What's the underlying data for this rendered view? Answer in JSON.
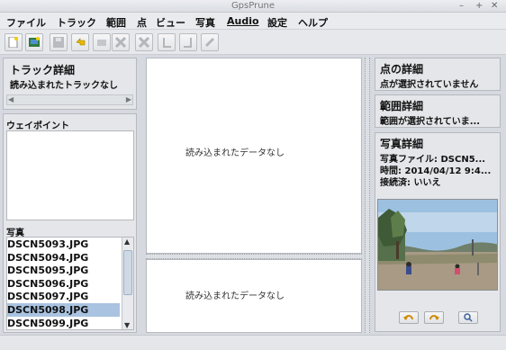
{
  "window": {
    "title": "GpsPrune",
    "minimize": "–",
    "maximize": "+",
    "close": "✕"
  },
  "menu": [
    "ファイル",
    "トラック",
    "範囲",
    "点",
    "ビュー",
    "写真",
    "Audio",
    "設定",
    "ヘルプ"
  ],
  "toolbar": {
    "icons": [
      "new-icon",
      "open-icon",
      "save-icon",
      "undo-icon",
      "edit-point-icon",
      "delete-point-icon",
      "delete-range-icon",
      "mark-start-icon",
      "mark-end-icon",
      "connect-icon"
    ]
  },
  "left": {
    "track_title": "トラック詳細",
    "track_status": "読み込まれたトラックなし",
    "waypoints_title": "ウェイポイント",
    "photos_title": "写真",
    "photos": [
      "DSCN5093.JPG",
      "DSCN5094.JPG",
      "DSCN5095.JPG",
      "DSCN5096.JPG",
      "DSCN5097.JPG",
      "DSCN5098.JPG",
      "DSCN5099.JPG"
    ],
    "selected_photo_index": 5
  },
  "center": {
    "map_nodata": "読み込まれたデータなし",
    "profile_nodata": "読み込まれたデータなし"
  },
  "right": {
    "point_title": "点の詳細",
    "point_status": "点が選択されていません",
    "range_title": "範囲詳細",
    "range_status": "範囲が選択されていま...",
    "photo_title": "写真詳細",
    "photo_file": "写真ファイル: DSCN5...",
    "photo_time": "時間: 2014/04/12 9:4...",
    "photo_connected": "接続済: いいえ",
    "photo_buttons": [
      "rotate-left-icon",
      "rotate-right-icon",
      "zoom-icon"
    ]
  },
  "colors": {
    "selection": "#a9c3e0",
    "background": "#d6d9df",
    "sky": "#9cc1e0",
    "ground": "#a89a84"
  }
}
